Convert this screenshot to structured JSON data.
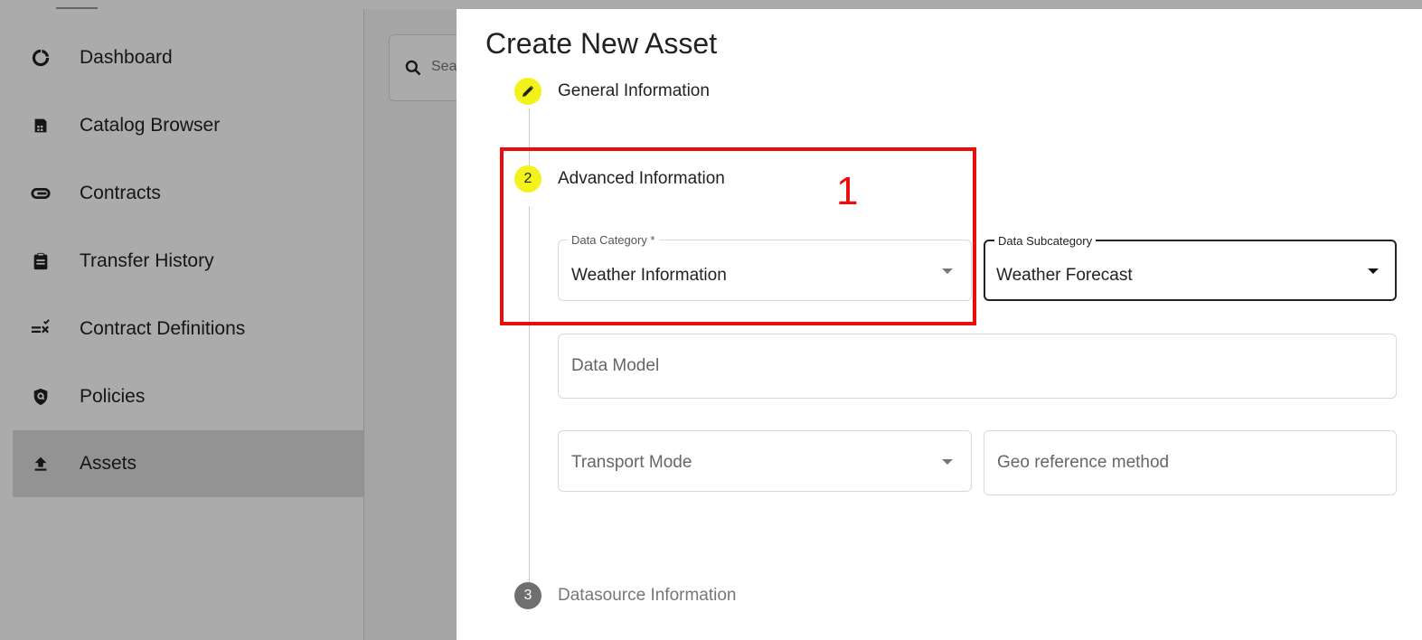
{
  "sidebar": {
    "items": [
      {
        "label": "Dashboard",
        "icon": "dashboard-icon",
        "active": false
      },
      {
        "label": "Catalog Browser",
        "icon": "catalog-icon",
        "active": false
      },
      {
        "label": "Contracts",
        "icon": "paperclip-icon",
        "active": false
      },
      {
        "label": "Transfer History",
        "icon": "clipboard-icon",
        "active": false
      },
      {
        "label": "Contract Definitions",
        "icon": "rule-icon",
        "active": false
      },
      {
        "label": "Policies",
        "icon": "shield-icon",
        "active": false
      },
      {
        "label": "Assets",
        "icon": "upload-icon",
        "active": true
      }
    ]
  },
  "search": {
    "placeholder_visible": "Sea"
  },
  "dialog": {
    "title": "Create New Asset",
    "steps": [
      {
        "badge": "",
        "icon": "pencil-icon",
        "label": "General Information",
        "state": "completed"
      },
      {
        "badge": "2",
        "label": "Advanced Information",
        "state": "active"
      },
      {
        "badge": "3",
        "label": "Datasource Information",
        "state": "pending"
      }
    ],
    "fields": {
      "data_category": {
        "label": "Data Category *",
        "value": "Weather Information"
      },
      "data_subcategory": {
        "label": "Data Subcategory",
        "value": "Weather Forecast"
      },
      "data_model": {
        "placeholder": "Data Model"
      },
      "transport_mode": {
        "placeholder": "Transport Mode"
      },
      "geo_reference": {
        "placeholder": "Geo reference method"
      }
    }
  },
  "annotation": {
    "label": "1",
    "color": "#ee0b0b"
  },
  "colors": {
    "step_active": "#f3f21a",
    "step_pending": "#6f6f6f",
    "overlay": "rgba(0,0,0,0.33)"
  }
}
